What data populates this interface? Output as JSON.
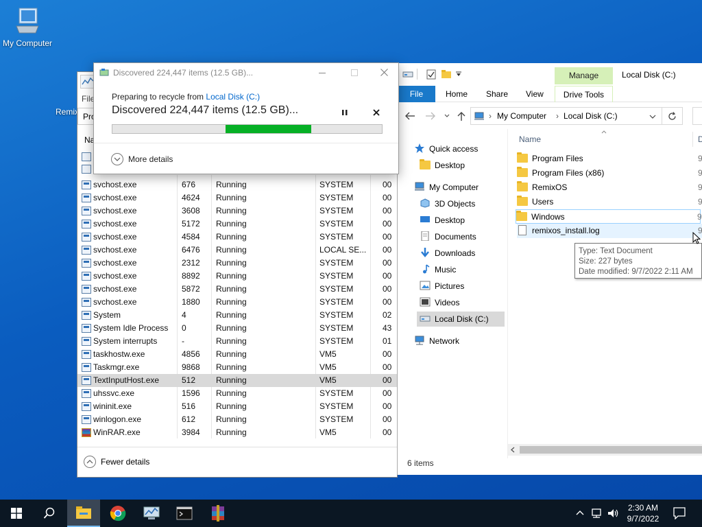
{
  "desktop": {
    "icons": [
      {
        "label": "My Computer"
      },
      {
        "label": "Remix"
      }
    ]
  },
  "dialog": {
    "title": "Discovered 224,447 items (12.5 GB)...",
    "prepare_prefix": "Preparing to recycle from ",
    "prepare_link": "Local Disk (C:)",
    "status": "Discovered 224,447 items (12.5 GB)...",
    "more_details": "More details",
    "progress_fraction": 0.42
  },
  "taskmgr": {
    "menu_file": "File",
    "tab_partial": "Pro",
    "col_partial": "Na",
    "rows": [
      {
        "name": "svchost.exe",
        "pid": "676",
        "status": "Running",
        "user": "SYSTEM",
        "cpu": "00"
      },
      {
        "name": "svchost.exe",
        "pid": "4624",
        "status": "Running",
        "user": "SYSTEM",
        "cpu": "00"
      },
      {
        "name": "svchost.exe",
        "pid": "3608",
        "status": "Running",
        "user": "SYSTEM",
        "cpu": "00"
      },
      {
        "name": "svchost.exe",
        "pid": "5172",
        "status": "Running",
        "user": "SYSTEM",
        "cpu": "00"
      },
      {
        "name": "svchost.exe",
        "pid": "4584",
        "status": "Running",
        "user": "SYSTEM",
        "cpu": "00"
      },
      {
        "name": "svchost.exe",
        "pid": "6476",
        "status": "Running",
        "user": "LOCAL SE...",
        "cpu": "00"
      },
      {
        "name": "svchost.exe",
        "pid": "2312",
        "status": "Running",
        "user": "SYSTEM",
        "cpu": "00"
      },
      {
        "name": "svchost.exe",
        "pid": "8892",
        "status": "Running",
        "user": "SYSTEM",
        "cpu": "00"
      },
      {
        "name": "svchost.exe",
        "pid": "5872",
        "status": "Running",
        "user": "SYSTEM",
        "cpu": "00"
      },
      {
        "name": "svchost.exe",
        "pid": "1880",
        "status": "Running",
        "user": "SYSTEM",
        "cpu": "00"
      },
      {
        "name": "System",
        "pid": "4",
        "status": "Running",
        "user": "SYSTEM",
        "cpu": "02"
      },
      {
        "name": "System Idle Process",
        "pid": "0",
        "status": "Running",
        "user": "SYSTEM",
        "cpu": "43"
      },
      {
        "name": "System interrupts",
        "pid": "-",
        "status": "Running",
        "user": "SYSTEM",
        "cpu": "01"
      },
      {
        "name": "taskhostw.exe",
        "pid": "4856",
        "status": "Running",
        "user": "VM5",
        "cpu": "00"
      },
      {
        "name": "Taskmgr.exe",
        "pid": "9868",
        "status": "Running",
        "user": "VM5",
        "cpu": "00"
      },
      {
        "name": "TextInputHost.exe",
        "pid": "512",
        "status": "Running",
        "user": "VM5",
        "cpu": "00"
      },
      {
        "name": "uhssvc.exe",
        "pid": "1596",
        "status": "Running",
        "user": "SYSTEM",
        "cpu": "00"
      },
      {
        "name": "wininit.exe",
        "pid": "516",
        "status": "Running",
        "user": "SYSTEM",
        "cpu": "00"
      },
      {
        "name": "winlogon.exe",
        "pid": "612",
        "status": "Running",
        "user": "SYSTEM",
        "cpu": "00"
      },
      {
        "name": "WinRAR.exe",
        "pid": "3984",
        "status": "Running",
        "user": "VM5",
        "cpu": "00"
      }
    ],
    "fewer_details": "Fewer details"
  },
  "explorer": {
    "ribbon": {
      "manage": "Manage",
      "window_title": "Local Disk (C:)",
      "tabs": [
        "File",
        "Home",
        "Share",
        "View",
        "Drive Tools"
      ]
    },
    "breadcrumb": [
      "My Computer",
      "Local Disk (C:)"
    ],
    "nav": [
      {
        "label": "Quick access"
      },
      {
        "label": "Desktop"
      },
      {
        "label": "My Computer"
      },
      {
        "label": "3D Objects"
      },
      {
        "label": "Desktop"
      },
      {
        "label": "Documents"
      },
      {
        "label": "Downloads"
      },
      {
        "label": "Music"
      },
      {
        "label": "Pictures"
      },
      {
        "label": "Videos"
      },
      {
        "label": "Local Disk (C:)"
      },
      {
        "label": "Network"
      }
    ],
    "col_name": "Name",
    "col_partial": "D",
    "files": [
      {
        "name": "Program Files",
        "date": "9,"
      },
      {
        "name": "Program Files (x86)",
        "date": "9,"
      },
      {
        "name": "RemixOS",
        "date": "9,"
      },
      {
        "name": "Users",
        "date": "9,"
      },
      {
        "name": "Windows",
        "date": "9,"
      },
      {
        "name": "remixos_install.log",
        "date": "9,"
      }
    ],
    "tooltip": {
      "type": "Type: Text Document",
      "size": "Size: 227 bytes",
      "modified": "Date modified: 9/7/2022 2:11 AM"
    },
    "status_items": "6 items"
  },
  "taskbar": {
    "time": "2:30 AM",
    "date": "9/7/2022"
  },
  "colors": {
    "accent": "#0063b1",
    "progress_green": "#06b025",
    "manage_tab": "#d6f0b8",
    "selected_nav": "#cce8ff",
    "taskbar": "#0b1723"
  }
}
